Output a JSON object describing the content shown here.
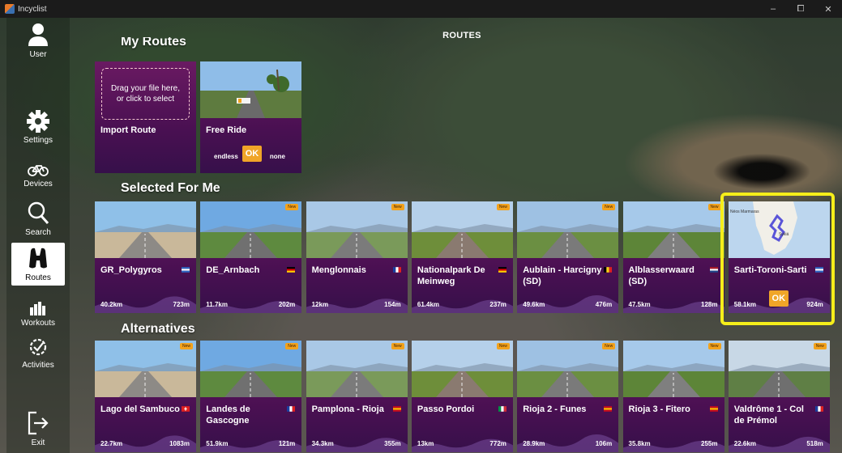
{
  "window": {
    "title": "Incyclist",
    "minimize": "–",
    "maximize": "⧠",
    "close": "✕"
  },
  "page_title": "ROUTES",
  "sidebar": [
    {
      "label": "User",
      "icon": "user-icon"
    },
    {
      "label": "Settings",
      "icon": "gear-icon"
    },
    {
      "label": "Devices",
      "icon": "bicycle-icon"
    },
    {
      "label": "Search",
      "icon": "search-icon"
    },
    {
      "label": "Routes",
      "icon": "binoculars-icon",
      "active": true
    },
    {
      "label": "Workouts",
      "icon": "workouts-icon"
    },
    {
      "label": "Activities",
      "icon": "activities-icon"
    },
    {
      "label": "Exit",
      "icon": "exit-icon"
    }
  ],
  "sections": {
    "my_routes": "My Routes",
    "selected": "Selected For Me",
    "alternatives": "Alternatives"
  },
  "my_routes": {
    "import": {
      "name": "Import Route",
      "drop_text": "Drag your file here, or click to select"
    },
    "free_ride": {
      "name": "Free Ride",
      "distance": "endless",
      "elevation": "none",
      "ok": "OK"
    }
  },
  "selected": [
    {
      "name": "GR_Polygyros",
      "distance": "40.2km",
      "elevation": "723m",
      "flag": "greece",
      "new": false
    },
    {
      "name": "DE_Arnbach",
      "distance": "11.7km",
      "elevation": "202m",
      "flag": "germany",
      "new": true
    },
    {
      "name": "Menglonnais",
      "distance": "12km",
      "elevation": "154m",
      "flag": "france",
      "new": true
    },
    {
      "name": "Nationalpark De Meinweg",
      "distance": "61.4km",
      "elevation": "237m",
      "flag": "germany",
      "new": true
    },
    {
      "name": "Aublain - Harcigny (SD)",
      "distance": "49.6km",
      "elevation": "476m",
      "flag": "belgium",
      "new": true
    },
    {
      "name": "Alblasserwaard (SD)",
      "distance": "47.5km",
      "elevation": "128m",
      "flag": "netherlands",
      "new": true
    },
    {
      "name": "Sarti-Toroni-Sarti",
      "distance": "58.1km",
      "elevation": "924m",
      "flag": "greece",
      "new": false,
      "ok": "OK",
      "map_label": "Néos Marmaras",
      "map_town": "Sykiá"
    }
  ],
  "alternatives": [
    {
      "name": "Lago del Sambuco",
      "distance": "22.7km",
      "elevation": "1083m",
      "flag": "switzerland",
      "new": true
    },
    {
      "name": "Landes de Gascogne",
      "distance": "51.9km",
      "elevation": "121m",
      "flag": "france",
      "new": true
    },
    {
      "name": "Pamplona - Rioja",
      "distance": "34.3km",
      "elevation": "355m",
      "flag": "spain",
      "new": true
    },
    {
      "name": "Passo Pordoi",
      "distance": "13km",
      "elevation": "772m",
      "flag": "italy",
      "new": true
    },
    {
      "name": "Rioja 2 - Funes",
      "distance": "28.9km",
      "elevation": "106m",
      "flag": "spain",
      "new": true
    },
    {
      "name": "Rioja 3 - Fitero",
      "distance": "35.8km",
      "elevation": "255m",
      "flag": "spain",
      "new": true
    },
    {
      "name": "Valdrôme 1 - Col de Prémol",
      "distance": "22.6km",
      "elevation": "518m",
      "flag": "france",
      "new": true
    }
  ],
  "new_badge": "New",
  "colors": {
    "card_top": "#6a1a62",
    "card_bottom": "#36104a",
    "ok": "#f0a528",
    "highlight": "#f5ee1a",
    "new_badge": "#f2a21c"
  }
}
